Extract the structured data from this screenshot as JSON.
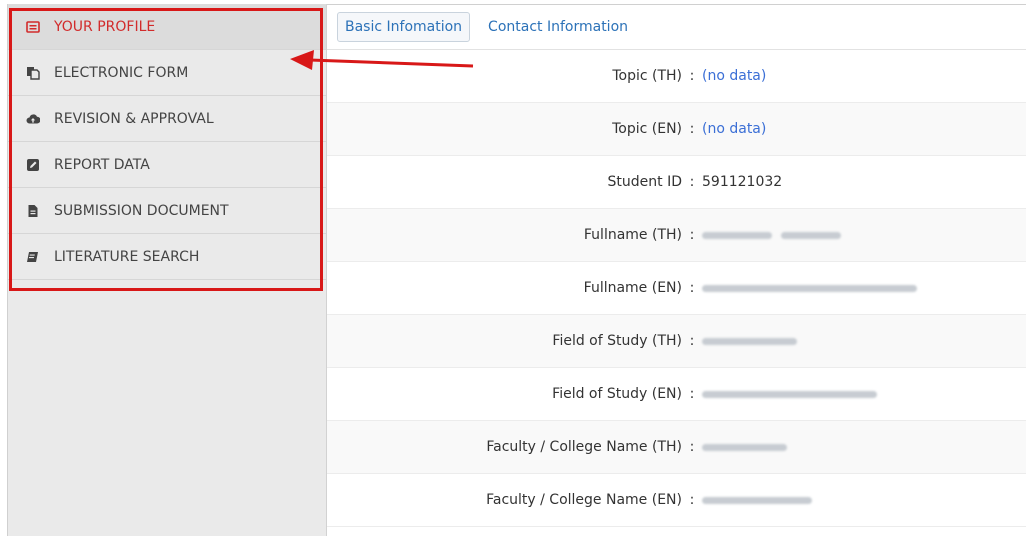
{
  "sidebar": {
    "items": [
      {
        "label": "YOUR PROFILE",
        "icon": "profile-card-icon",
        "active": true
      },
      {
        "label": "ELECTRONIC FORM",
        "icon": "copy-form-icon",
        "active": false
      },
      {
        "label": "REVISION & APPROVAL",
        "icon": "cloud-upload-icon",
        "active": false
      },
      {
        "label": "REPORT DATA",
        "icon": "edit-icon",
        "active": false
      },
      {
        "label": "SUBMISSION DOCUMENT",
        "icon": "file-text-icon",
        "active": false
      },
      {
        "label": "LITERATURE SEARCH",
        "icon": "book-icon",
        "active": false
      }
    ]
  },
  "tabs": [
    {
      "label": "Basic Infomation",
      "selected": true
    },
    {
      "label": "Contact Information",
      "selected": false
    }
  ],
  "fields": [
    {
      "label": "Topic (TH)",
      "sep": ":",
      "value": "(no data)",
      "nodata": true
    },
    {
      "label": "Topic (EN)",
      "sep": ":",
      "value": "(no data)",
      "nodata": true
    },
    {
      "label": "Student ID",
      "sep": ":",
      "value": "591121032",
      "nodata": false
    },
    {
      "label": "Fullname (TH)",
      "sep": ":",
      "value": "",
      "blurred": true
    },
    {
      "label": "Fullname (EN)",
      "sep": ":",
      "value": "",
      "blurred": true
    },
    {
      "label": "Field of Study (TH)",
      "sep": ":",
      "value": "",
      "blurred": true
    },
    {
      "label": "Field of Study (EN)",
      "sep": ":",
      "value": "",
      "blurred": true
    },
    {
      "label": "Faculty / College Name (TH)",
      "sep": ":",
      "value": "",
      "blurred": true
    },
    {
      "label": "Faculty / College Name (EN)",
      "sep": ":",
      "value": "",
      "blurred": true
    }
  ],
  "colors": {
    "active_menu": "#d22b2b",
    "highlight_frame": "#d81818",
    "link": "#2c72b8",
    "nodata": "#3b6fd6"
  }
}
